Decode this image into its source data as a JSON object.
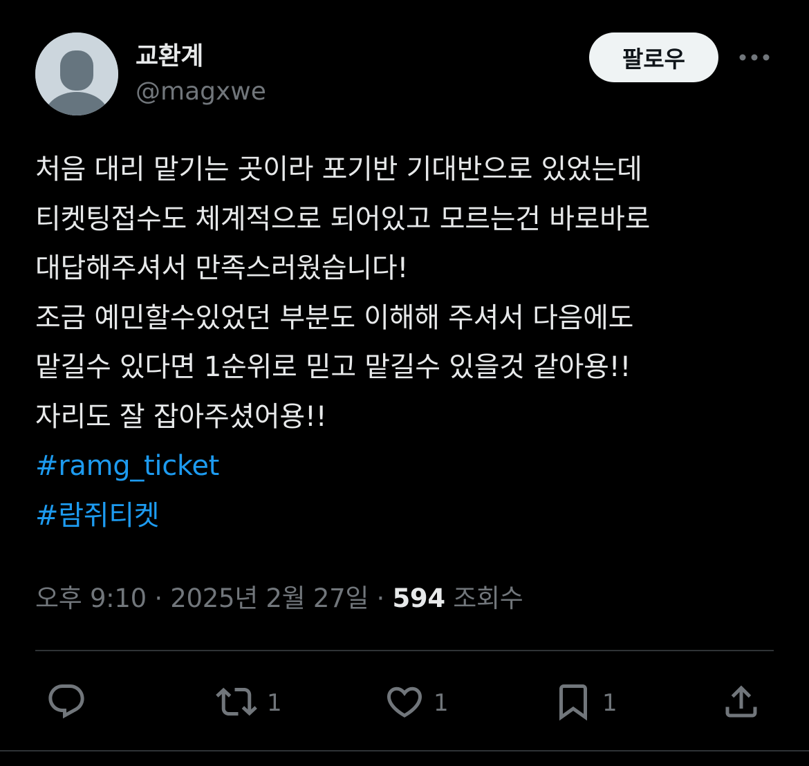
{
  "user": {
    "display_name": "교환계",
    "handle": "@magxwe"
  },
  "follow_button": {
    "label": "팔로우"
  },
  "tweet": {
    "lines": [
      "처음 대리 맡기는 곳이라 포기반 기대반으로 있었는데",
      "티켓팅접수도 체계적으로 되어있고 모르는건 바로바로",
      "대답해주셔서 만족스러웠습니다!",
      "조금 예민할수있었던 부분도 이해해 주셔서 다음에도",
      "맡길수 있다면 1순위로 믿고 맡길수 있을것 같아용!!",
      "자리도 잘 잡아주셨어용!!"
    ],
    "hashtags": [
      "#ramg_ticket",
      "#람쥐티켓"
    ]
  },
  "meta": {
    "time": "오후 9:10",
    "separator": "·",
    "date": "2025년 2월 27일",
    "views_count": "594",
    "views_label": "조회수"
  },
  "actions": {
    "reply_count": "",
    "retweet_count": "1",
    "like_count": "1",
    "bookmark_count": "1"
  },
  "icons": {
    "avatar": "default-avatar-icon",
    "more": "more-dots-icon",
    "reply": "reply-icon",
    "retweet": "retweet-icon",
    "like": "heart-icon",
    "bookmark": "bookmark-icon",
    "share": "share-icon"
  },
  "colors": {
    "background": "#000000",
    "text": "#e7e9ea",
    "muted": "#71767b",
    "link": "#1d9bf0",
    "divider": "#2f3336",
    "follow_bg": "#eff3f4"
  }
}
